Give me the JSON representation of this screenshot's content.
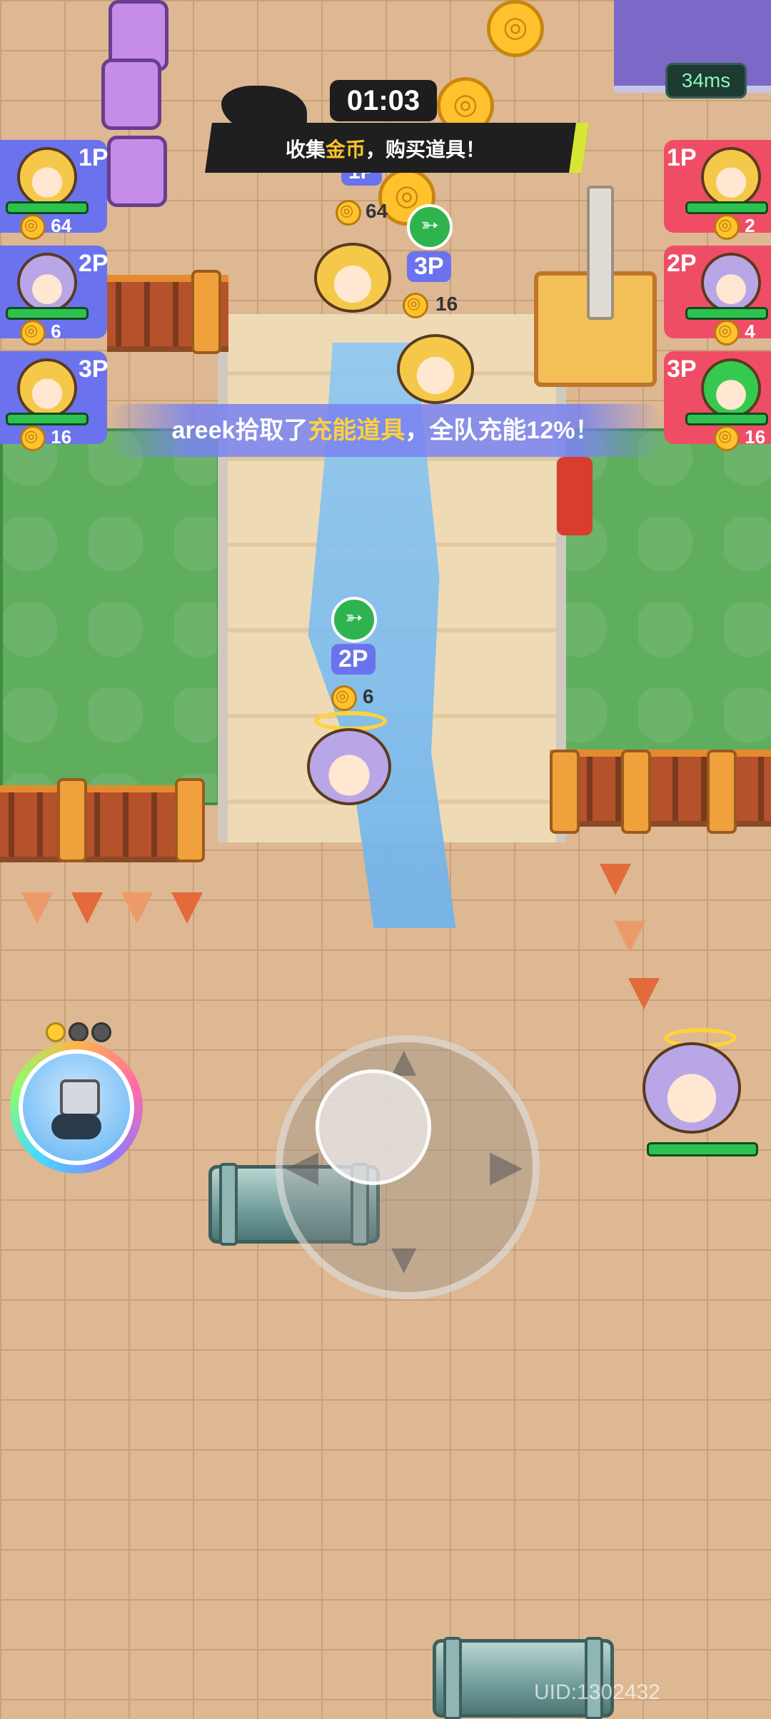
{
  "match": {
    "timer": "01:03",
    "objective_prefix": "收集",
    "objective_highlight": "金币",
    "objective_suffix": "，购买道具！",
    "ping": "34ms"
  },
  "left_team": [
    {
      "tag": "1P",
      "coins": "64"
    },
    {
      "tag": "2P",
      "coins": "6"
    },
    {
      "tag": "3P",
      "coins": "16"
    }
  ],
  "right_team": [
    {
      "tag": "1P",
      "coins": "2"
    },
    {
      "tag": "2P",
      "coins": "4"
    },
    {
      "tag": "3P",
      "coins": "16"
    }
  ],
  "notice": {
    "player": "areek",
    "verb": "拾取了",
    "item": "充能道具",
    "rest": "，全队充能12%！"
  },
  "field_players": [
    {
      "tag": "1P",
      "coins": "64"
    },
    {
      "tag": "3P",
      "coins": "16"
    },
    {
      "tag": "2P",
      "coins": "6"
    }
  ],
  "skill": {
    "charges_total": 3,
    "charges_ready": 1
  },
  "uid": "UID:1302432",
  "colors": {
    "left_team": "#6b72ee",
    "right_team": "#ef4d66",
    "highlight": "#ffc42a",
    "ping_text": "#8ef7b5"
  },
  "icons": [
    "coin-icon",
    "wing-icon",
    "skill-icon",
    "joystick"
  ]
}
